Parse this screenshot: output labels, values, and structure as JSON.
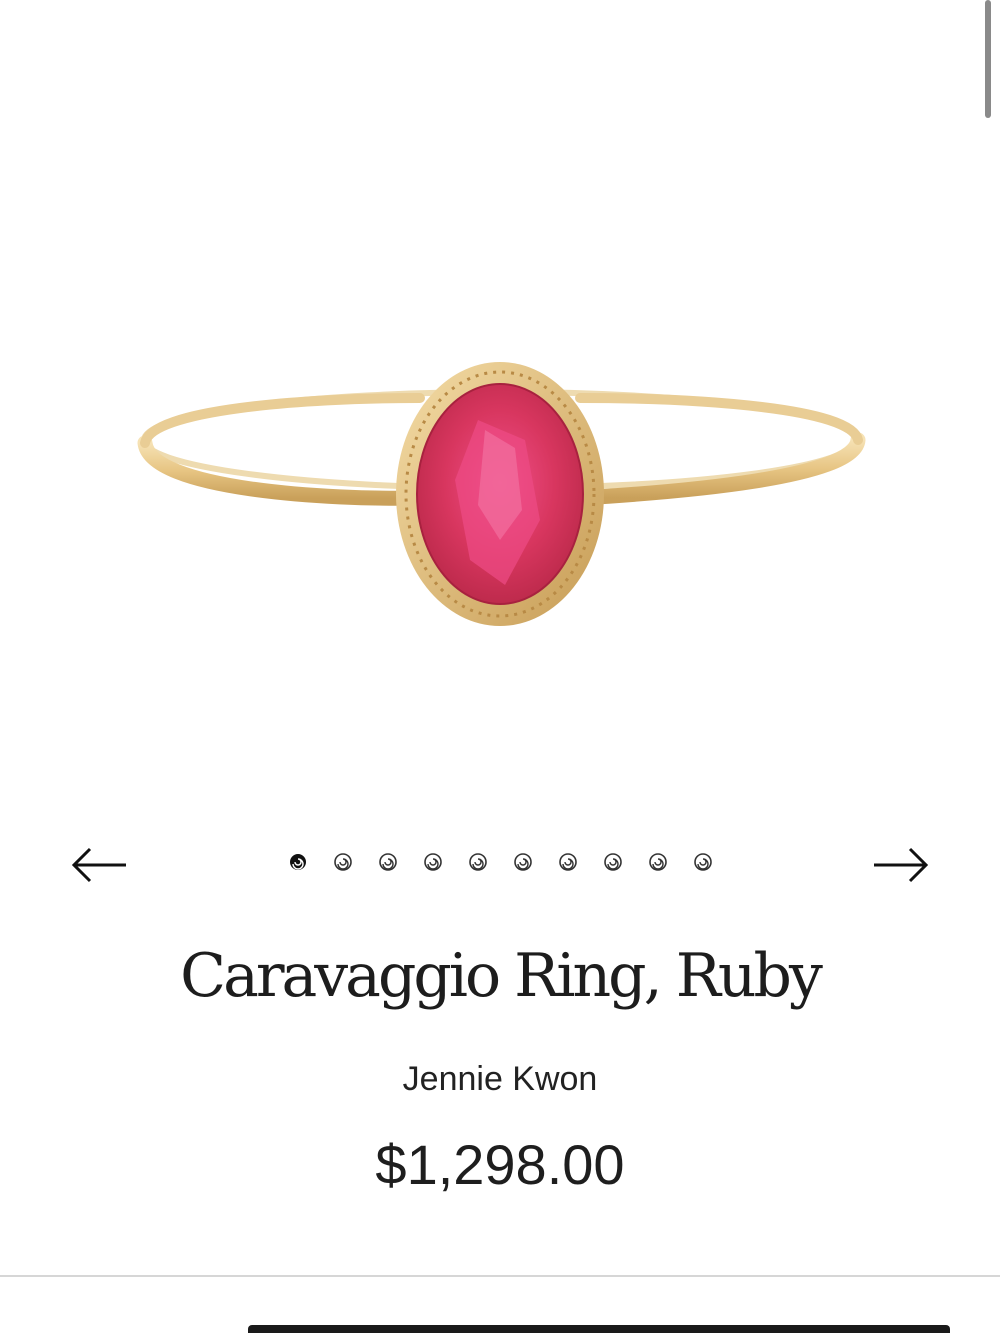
{
  "product": {
    "title": "Caravaggio Ring, Ruby",
    "vendor": "Jennie Kwon",
    "price": "$1,298.00"
  },
  "carousel": {
    "total_slides": 10,
    "active_index": 0,
    "prev_icon": "arrow-left-icon",
    "next_icon": "arrow-right-icon"
  },
  "colors": {
    "gold": "#e6c585",
    "ruby": "#d6345e",
    "text": "#1f1f1f",
    "divider": "#d6d6d6"
  }
}
